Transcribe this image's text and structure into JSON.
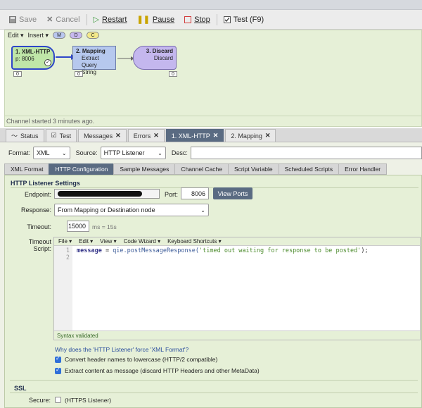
{
  "toolbar": {
    "save": "Save",
    "cancel": "Cancel",
    "restart": "Restart",
    "pause": "Pause",
    "stop": "Stop",
    "test": "Test (F9)"
  },
  "canvas": {
    "menu": {
      "edit": "Edit ▾",
      "insert": "Insert ▾",
      "pills": [
        "M",
        "D",
        "C"
      ]
    },
    "nodes": [
      {
        "title": "1. XML-HTTP",
        "sub": "p: 8006",
        "count": "0"
      },
      {
        "title": "2. Mapping",
        "line1": "Extract Query",
        "line2": "String",
        "count": "0"
      },
      {
        "title": "3. Discard",
        "line1": "Discard",
        "count": "0"
      }
    ],
    "status": "Channel started 3 minutes ago."
  },
  "tabs": [
    {
      "label": "Status",
      "closable": false
    },
    {
      "label": "Test",
      "closable": false
    },
    {
      "label": "Messages",
      "closable": true
    },
    {
      "label": "Errors",
      "closable": true
    },
    {
      "label": "1. XML-HTTP",
      "closable": true,
      "active": true
    },
    {
      "label": "2. Mapping",
      "closable": true
    }
  ],
  "settings": {
    "format_label": "Format:",
    "format_value": "XML",
    "source_label": "Source:",
    "source_value": "HTTP Listener",
    "desc_label": "Desc:"
  },
  "subtabs": [
    "XML Format",
    "HTTP Configuration",
    "Sample Messages",
    "Channel Cache",
    "Script Variable",
    "Scheduled Scripts",
    "Error Handler"
  ],
  "http": {
    "group_title": "HTTP Listener Settings",
    "endpoint_label": "Endpoint:",
    "port_label": "Port:",
    "port_value": "8006",
    "view_ports": "View Ports",
    "response_label": "Response:",
    "response_value": "From Mapping or Destination node",
    "timeout_label": "Timeout:",
    "timeout_value": "15000",
    "timeout_hint": "ms = 15s",
    "timeout_script_label": "Timeout Script:",
    "editor_menu": [
      "File ▾",
      "Edit ▾",
      "View ▾",
      "Code Wizard ▾",
      "Keyboard Shortcuts ▾"
    ],
    "code_line1": {
      "v": "message",
      "o": " = ",
      "f": "qie.postMessageResponse(",
      "s": "'timed out waiting for response to be posted'",
      "end": ");"
    },
    "line_numbers": [
      "1",
      "2"
    ],
    "syntax_status": "Syntax validated",
    "why_link": "Why does the 'HTTP Listener' force 'XML Format'?",
    "chk1": "Convert header names to lowercase (HTTP/2 compatible)",
    "chk2": "Extract content as message (discard HTTP Headers and other MetaData)"
  },
  "ssl": {
    "group_title": "SSL",
    "secure_label": "Secure:",
    "secure_hint": "(HTTPS Listener)"
  }
}
